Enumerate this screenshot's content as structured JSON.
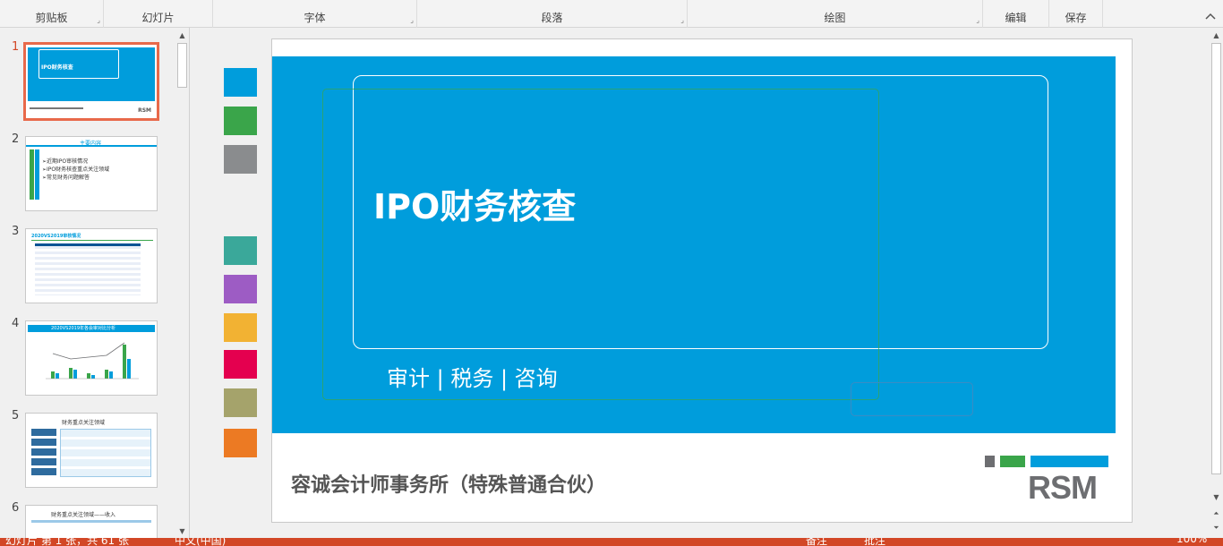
{
  "ribbon": {
    "groups": [
      {
        "label": "剪贴板",
        "launcher": "⌟"
      },
      {
        "label": "幻灯片",
        "launcher": ""
      },
      {
        "label": "字体",
        "launcher": "⌟"
      },
      {
        "label": "段落",
        "launcher": "⌟"
      },
      {
        "label": "绘图",
        "launcher": "⌟"
      },
      {
        "label": "编辑",
        "launcher": ""
      },
      {
        "label": "保存",
        "launcher": ""
      }
    ],
    "collapse_icon": "chevron-up-icon"
  },
  "thumbnails": [
    {
      "number": "1",
      "title": "IPO财务核查",
      "active": true,
      "footer": "RSM"
    },
    {
      "number": "2",
      "title": "主要内容",
      "items": [
        "➢近期IPO审核情况",
        "➢IPO财务核查重点关注领域",
        "➢常见财务问题解答"
      ]
    },
    {
      "number": "3",
      "title": "2020VS2019审核情况"
    },
    {
      "number": "4",
      "title": "2020VS2019年各会审对比分析"
    },
    {
      "number": "5",
      "title": "财务重点关注领域"
    },
    {
      "number": "6",
      "title": "财务重点关注领域——收入"
    }
  ],
  "slide": {
    "title": "IPO财务核查",
    "subtitle": "审计 | 税务 | 咨询",
    "company": "容诚会计师事务所（特殊普通合伙）",
    "logo_text": "RSM",
    "colors": {
      "band": "#009ddc",
      "logo_gray": "#6d6e71",
      "logo_green": "#3aa54a",
      "logo_blue": "#009ddc"
    }
  },
  "swatches": [
    "#009ddc",
    "#3aa54a",
    "#8a8c8e",
    "#3aa89a",
    "#9d5cc4",
    "#f2b233",
    "#e4004f",
    "#a5a36b",
    "#ec7a23"
  ],
  "statusbar": {
    "slide_info": "幻灯片 第 1 张，共 61 张",
    "language": "中文(中国)",
    "notes": "备注",
    "comments": "批注",
    "zoom": "100%",
    "color": "#d24726"
  }
}
